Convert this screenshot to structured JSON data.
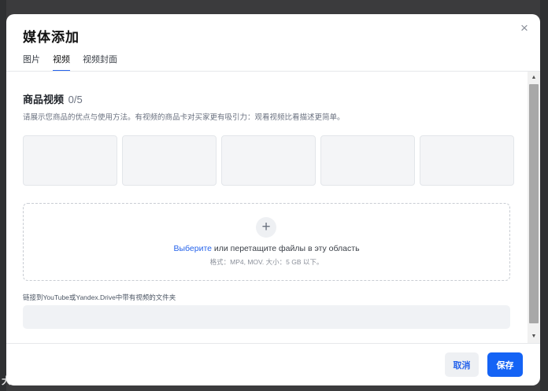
{
  "modal": {
    "title": "媒体添加",
    "close_symbol": "×"
  },
  "tabs": [
    {
      "label": "图片",
      "active": false
    },
    {
      "label": "视频",
      "active": true
    },
    {
      "label": "视频封面",
      "active": false
    }
  ],
  "section": {
    "title": "商品视频",
    "count": "0/5",
    "description": "请展示您商品的优点与使用方法。有视频的商品卡对买家更有吸引力：观看视频比看描述更简单。"
  },
  "video_slot_count": 5,
  "upload": {
    "plus_symbol": "+",
    "link_text": "Выберите",
    "text_after_link": " или перетащите файлы в эту область",
    "hint": "格式：MP4, MOV. 大小：5 GB 以下。"
  },
  "link_field": {
    "label": "链接到YouTube或Yandex.Drive中带有视频的文件夹",
    "value": "",
    "placeholder": ""
  },
  "footer": {
    "cancel_label": "取消",
    "save_label": "保存"
  },
  "watermark": "大数跨境",
  "icons": {
    "close": "close-icon",
    "plus": "plus-icon",
    "scroll_up": "arrow-up-icon",
    "scroll_down": "arrow-down-icon"
  },
  "colors": {
    "accent": "#1463f5",
    "link": "#2563eb",
    "backdrop": "#3b3b3d"
  }
}
